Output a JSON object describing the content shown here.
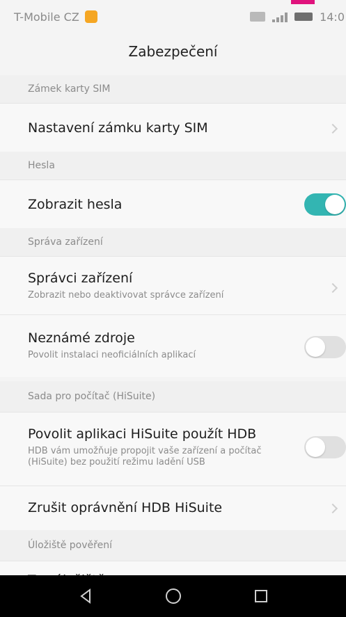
{
  "status_bar": {
    "carrier": "T-Mobile CZ",
    "time": "14:0"
  },
  "header": {
    "title": "Zabezpečení"
  },
  "sections": {
    "sim_lock": {
      "header": "Zámek karty SIM",
      "row_title": "Nastavení zámku karty SIM"
    },
    "passwords": {
      "header": "Hesla",
      "row_title": "Zobrazit hesla",
      "toggle_state": "on"
    },
    "device_admin": {
      "header": "Správa zařízení",
      "admins_title": "Správci zařízení",
      "admins_sub": "Zobrazit nebo deaktivovat správce zařízení",
      "unknown_sources_title": "Neznámé zdroje",
      "unknown_sources_sub": "Povolit instalaci neoficiálních aplikací",
      "unknown_sources_state": "off"
    },
    "hisuite": {
      "header": "Sada pro počítač (HiSuite)",
      "allow_hdb_title": "Povolit aplikaci HiSuite použít HDB",
      "allow_hdb_sub": "HDB vám umožňuje propojit vaše zařízení a počítač (HiSuite) bez použití režimu ladění USB",
      "allow_hdb_state": "off",
      "revoke_title": "Zrušit oprávnění HDB HiSuite"
    },
    "credentials": {
      "header": "Úložiště pověření",
      "storage_type_title": "Typ úložiště"
    }
  },
  "colors": {
    "accent": "#33b5b2",
    "brand_pink": "#e0137d"
  },
  "icons": {
    "nav_back": "back-triangle-icon",
    "nav_home": "home-circle-icon",
    "nav_recent": "recent-square-icon"
  }
}
